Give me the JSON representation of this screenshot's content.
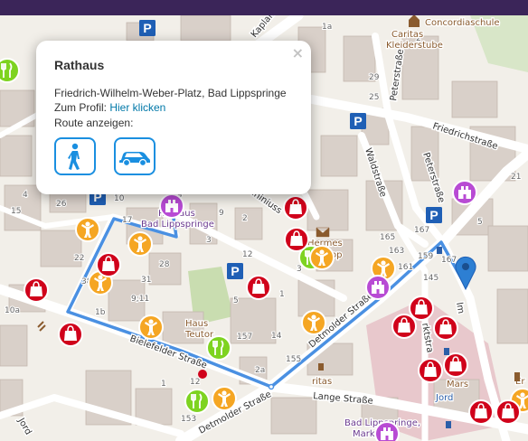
{
  "popup": {
    "title": "Rathaus",
    "close_symbol": "×",
    "address": "Friedrich-Wilhelm-Weber-Platz, Bad Lippspringe",
    "profile_prefix": "Zum Profil: ",
    "profile_link": "Hier klicken",
    "route_label": "Route anzeigen:",
    "route_buttons": [
      {
        "mode": "walk",
        "icon": "pedestrian-icon"
      },
      {
        "mode": "car",
        "icon": "car-icon"
      }
    ]
  },
  "map": {
    "streets": {
      "kaplan": "Kaplan",
      "peterstr": "Peterstraße",
      "friedrichstr": "Friedrichstraße",
      "waldstr": "Waldstraße",
      "peterstr2": "Peterstraße",
      "detmolder1": "Detmolder Straße",
      "detmolder2": "Detmolder Straße",
      "bielefelder": "Bielefelder Straße",
      "lange": "Lange Straße",
      "jord": "Jord",
      "ininius": "ininiuss",
      "im": "Im",
      "marktstr": "rktstra"
    },
    "pois": {
      "concordia": "Concordiaschule",
      "caritas_kleider_1": "Caritas",
      "caritas_kleider_2": "Kleiderstube",
      "rathaus_1": "Rathaus",
      "rathaus_2": "Bad Lippspringe",
      "hermes_1": "Hermes",
      "hermes_2": "op",
      "haus_1": "Haus",
      "haus_2": "Teutor",
      "caritas": "ritas",
      "mars": "Mars",
      "bad_lipp_bottom": "Bad Lippspringe,",
      "mark": "Mark",
      "jord2": "Jord",
      "er": "Er"
    },
    "house_numbers": [
      "167",
      "9",
      "2",
      "3",
      "7",
      "4",
      "10",
      "17",
      "15",
      "26",
      "22",
      "38",
      "28",
      "31",
      "3",
      "1",
      "1b",
      "12",
      "9;11",
      "10a",
      "5",
      "1",
      "12",
      "14",
      "155",
      "157",
      "2a",
      "153",
      "145",
      "159",
      "161",
      "163",
      "165",
      "5",
      "167",
      "1a",
      "2",
      "29",
      "25",
      "21"
    ],
    "colors": {
      "route": "#4a90e2",
      "shop": "#d0021b",
      "food": "#f5a623",
      "restaurant": "#7ed321",
      "townhall": "#b84bd4",
      "parking": "#1f5fb5",
      "marker": "#2d7fd3"
    }
  }
}
